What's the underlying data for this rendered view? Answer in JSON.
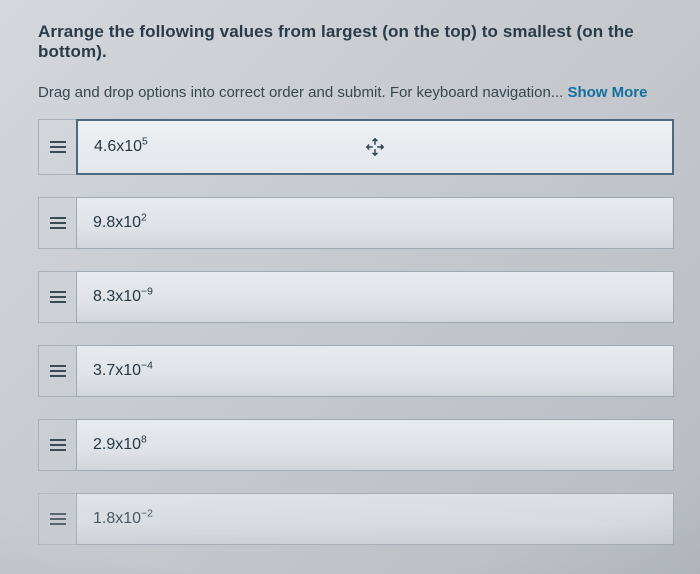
{
  "question": "Arrange the following values from largest (on the top) to smallest (on the bottom).",
  "instructions_prefix": "Drag and drop options into correct order and submit. For keyboard navigation... ",
  "show_more_label": "Show More",
  "items": [
    {
      "base": "4.6x10",
      "exp": "5",
      "active": true
    },
    {
      "base": "9.8x10",
      "exp": "2",
      "active": false
    },
    {
      "base": "8.3x10",
      "exp": "−9",
      "active": false
    },
    {
      "base": "3.7x10",
      "exp": "−4",
      "active": false
    },
    {
      "base": "2.9x10",
      "exp": "8",
      "active": false
    },
    {
      "base": "1.8x10",
      "exp": "−2",
      "active": false
    }
  ]
}
